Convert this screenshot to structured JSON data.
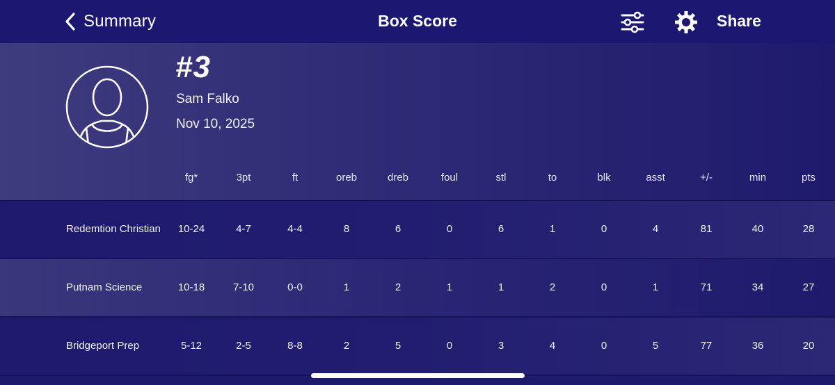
{
  "nav": {
    "back_label": "Summary",
    "title": "Box Score",
    "share_label": "Share",
    "icons": [
      "chevron-left-icon",
      "sliders-icon",
      "gear-icon"
    ]
  },
  "player": {
    "jersey": "#3",
    "name": "Sam Falko",
    "date": "Nov 10, 2025"
  },
  "columns": [
    "fg*",
    "3pt",
    "ft",
    "oreb",
    "dreb",
    "foul",
    "stl",
    "to",
    "blk",
    "asst",
    "+/-",
    "min",
    "pts"
  ],
  "rows": [
    {
      "team": "Redemtion Christian",
      "stats": [
        "10-24",
        "4-7",
        "4-4",
        "8",
        "6",
        "0",
        "6",
        "1",
        "0",
        "4",
        "81",
        "40",
        "28"
      ]
    },
    {
      "team": "Putnam Science",
      "stats": [
        "10-18",
        "7-10",
        "0-0",
        "1",
        "2",
        "1",
        "1",
        "2",
        "0",
        "1",
        "71",
        "34",
        "27"
      ]
    },
    {
      "team": "Bridgeport Prep",
      "stats": [
        "5-12",
        "2-5",
        "8-8",
        "2",
        "5",
        "0",
        "3",
        "4",
        "0",
        "5",
        "77",
        "36",
        "20"
      ]
    }
  ],
  "colors": {
    "background": "#1e1a6b",
    "panel": "#3f3b7e",
    "text": "#ffffff"
  }
}
